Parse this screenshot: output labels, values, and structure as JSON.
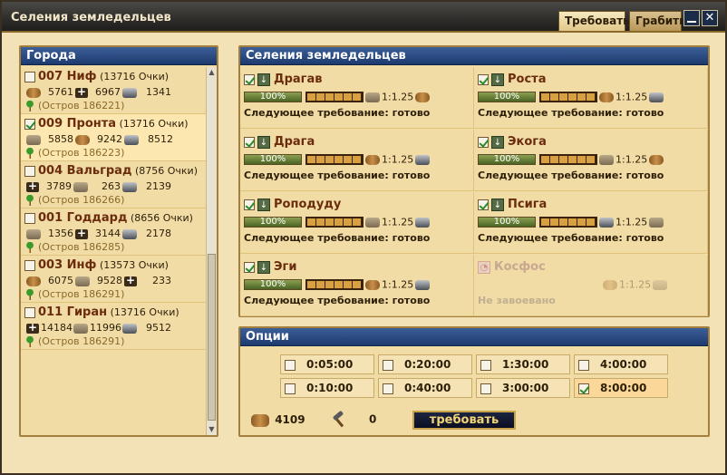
{
  "window": {
    "title": "Селения земледельцев",
    "tabs": [
      "Требовать",
      "Грабить"
    ]
  },
  "cities_panel": {
    "title": "Города",
    "items": [
      {
        "name": "007 Ниф",
        "points": "(13716 Очки)",
        "checked": false,
        "selected": false,
        "r1": "5761",
        "r1_icon": "wood-icon",
        "r2": "6967",
        "r2_icon": "plus-stone-icon",
        "r3": "1341",
        "r3_icon": "silver-icon",
        "island": "(Остров 186221)"
      },
      {
        "name": "009 Пронта",
        "points": "(13716 Очки)",
        "checked": true,
        "selected": true,
        "r1": "5858",
        "r1_icon": "stone-icon",
        "r2": "9242",
        "r2_icon": "wood-icon",
        "r3": "8512",
        "r3_icon": "silver-icon",
        "island": "(Остров 186223)"
      },
      {
        "name": "004 Вальград",
        "points": "(8756 Очки)",
        "checked": false,
        "selected": false,
        "r1": "3789",
        "r1_icon": "plus-wood-icon",
        "r2": "263",
        "r2_icon": "stone-icon",
        "r3": "2139",
        "r3_icon": "silver-icon",
        "island": "(Остров 186266)"
      },
      {
        "name": "001 Годдард",
        "points": "(8656 Очки)",
        "checked": false,
        "selected": false,
        "r1": "1356",
        "r1_icon": "stone-icon",
        "r2": "3144",
        "r2_icon": "plus-wood-icon",
        "r3": "2178",
        "r3_icon": "silver-icon",
        "island": "(Остров 186285)"
      },
      {
        "name": "003 Инф",
        "points": "(13573 Очки)",
        "checked": false,
        "selected": false,
        "r1": "6075",
        "r1_icon": "wood-icon",
        "r2": "9528",
        "r2_icon": "stone-icon",
        "r3": "233",
        "r3_icon": "plus-silver-icon",
        "island": "(Остров 186291)"
      },
      {
        "name": "011 Гиран",
        "points": "(13716 Очки)",
        "checked": false,
        "selected": false,
        "r1": "14184",
        "r1_icon": "plus-wood-icon",
        "r2": "11996",
        "r2_icon": "stone-icon",
        "r3": "9512",
        "r3_icon": "silver-icon",
        "island": "(Остров 186291)"
      }
    ]
  },
  "villages_panel": {
    "title": "Селения земледельцев",
    "items": [
      {
        "name": "Драгав",
        "checked": true,
        "progress": "100%",
        "progress_value": 1.0,
        "mood_segments": 6,
        "ratio": "1:1.25",
        "give_icon": "stone-icon",
        "get_icon": "wood-icon",
        "status": "Следующее требование: готово",
        "disabled": false
      },
      {
        "name": "Роста",
        "checked": true,
        "progress": "100%",
        "progress_value": 1.0,
        "mood_segments": 6,
        "ratio": "1:1.25",
        "give_icon": "wood-icon",
        "get_icon": "silver-icon",
        "status": "Следующее требование: готово",
        "disabled": false
      },
      {
        "name": "Драга",
        "checked": true,
        "progress": "100%",
        "progress_value": 1.0,
        "mood_segments": 6,
        "ratio": "1:1.25",
        "give_icon": "wood-icon",
        "get_icon": "silver-icon",
        "status": "Следующее требование: готово",
        "disabled": false
      },
      {
        "name": "Экога",
        "checked": true,
        "progress": "100%",
        "progress_value": 1.0,
        "mood_segments": 6,
        "ratio": "1:1.25",
        "give_icon": "stone-icon",
        "get_icon": "wood-icon",
        "status": "Следующее требование: готово",
        "disabled": false
      },
      {
        "name": "Роподуду",
        "checked": true,
        "progress": "100%",
        "progress_value": 1.0,
        "mood_segments": 6,
        "ratio": "1:1.25",
        "give_icon": "stone-icon",
        "get_icon": "silver-icon",
        "status": "Следующее требование: готово",
        "disabled": false
      },
      {
        "name": "Псига",
        "checked": true,
        "progress": "100%",
        "progress_value": 1.0,
        "mood_segments": 6,
        "ratio": "1:1.25",
        "give_icon": "silver-icon",
        "get_icon": "stone-icon",
        "status": "Следующее требование: готово",
        "disabled": false
      },
      {
        "name": "Эги",
        "checked": true,
        "progress": "100%",
        "progress_value": 1.0,
        "mood_segments": 6,
        "ratio": "1:1.25",
        "give_icon": "wood-icon",
        "get_icon": "silver-icon",
        "status": "Следующее требование: готово",
        "disabled": false
      },
      {
        "name": "Косфос",
        "checked": false,
        "progress": "",
        "progress_value": 0,
        "mood_segments": 0,
        "ratio": "1:1.25",
        "give_icon": "wood-icon",
        "get_icon": "stone-icon",
        "status": "Не завоевано",
        "disabled": true
      }
    ]
  },
  "options_panel": {
    "title": "Опции",
    "options": [
      {
        "label": "0:05:00",
        "checked": false
      },
      {
        "label": "0:20:00",
        "checked": false
      },
      {
        "label": "1:30:00",
        "checked": false
      },
      {
        "label": "4:00:00",
        "checked": false
      },
      {
        "label": "0:10:00",
        "checked": false
      },
      {
        "label": "0:40:00",
        "checked": false
      },
      {
        "label": "3:00:00",
        "checked": false
      },
      {
        "label": "8:00:00",
        "checked": true
      }
    ],
    "wood": "4109",
    "hammer": "0",
    "demand_button": "требовать"
  }
}
